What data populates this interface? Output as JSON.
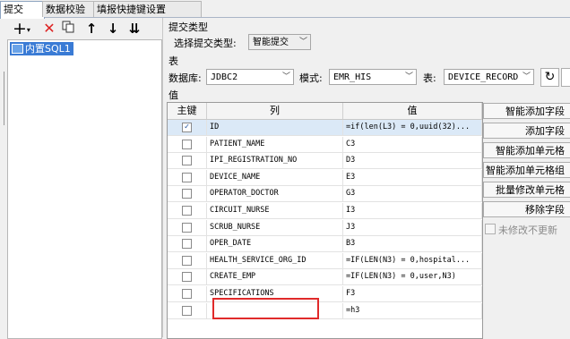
{
  "tabs": [
    "提交",
    "数据校验",
    "填报快捷键设置"
  ],
  "tree": {
    "item": "内置SQL1"
  },
  "submit_type": {
    "section": "提交类型",
    "label": "选择提交类型:",
    "value": "智能提交"
  },
  "table_section": {
    "label": "表",
    "db_label": "数据库:",
    "db_value": "JDBC2",
    "schema_label": "模式:",
    "schema_value": "EMR_HIS",
    "table_label": "表:",
    "table_value": "DEVICE_RECORD"
  },
  "value_section": {
    "label": "值"
  },
  "grid": {
    "headers": [
      "主键",
      "列",
      "值"
    ],
    "rows": [
      {
        "checked": "✓",
        "column": "ID",
        "value": "=if(len(L3) = 0,uuid(32)..."
      },
      {
        "checked": "",
        "column": "PATIENT_NAME",
        "value": "C3"
      },
      {
        "checked": "",
        "column": "IPI_REGISTRATION_NO",
        "value": "D3"
      },
      {
        "checked": "",
        "column": "DEVICE_NAME",
        "value": "E3"
      },
      {
        "checked": "",
        "column": "OPERATOR_DOCTOR",
        "value": "G3"
      },
      {
        "checked": "",
        "column": "CIRCUIT_NURSE",
        "value": "I3"
      },
      {
        "checked": "",
        "column": "SCRUB_NURSE",
        "value": "J3"
      },
      {
        "checked": "",
        "column": "OPER_DATE",
        "value": "B3"
      },
      {
        "checked": "",
        "column": "HEALTH_SERVICE_ORG_ID",
        "value": "=IF(LEN(N3) = 0,hospital..."
      },
      {
        "checked": "",
        "column": "CREATE_EMP",
        "value": "=IF(LEN(N3) = 0,user,N3)"
      },
      {
        "checked": "",
        "column": "SPECIFICATIONS",
        "value": "F3"
      },
      {
        "checked": "",
        "column": "",
        "value": "=h3"
      }
    ]
  },
  "side_buttons": [
    "智能添加字段",
    "添加字段",
    "智能添加单元格",
    "智能添加单元格组",
    "批量修改单元格",
    "移除字段"
  ],
  "unchanged_checkbox": "未修改不更新",
  "icons": [
    "add-icon",
    "delete-icon",
    "copy-icon",
    "arrow-up-icon",
    "arrow-down-icon",
    "move-bottom-icon",
    "refresh-icon"
  ]
}
